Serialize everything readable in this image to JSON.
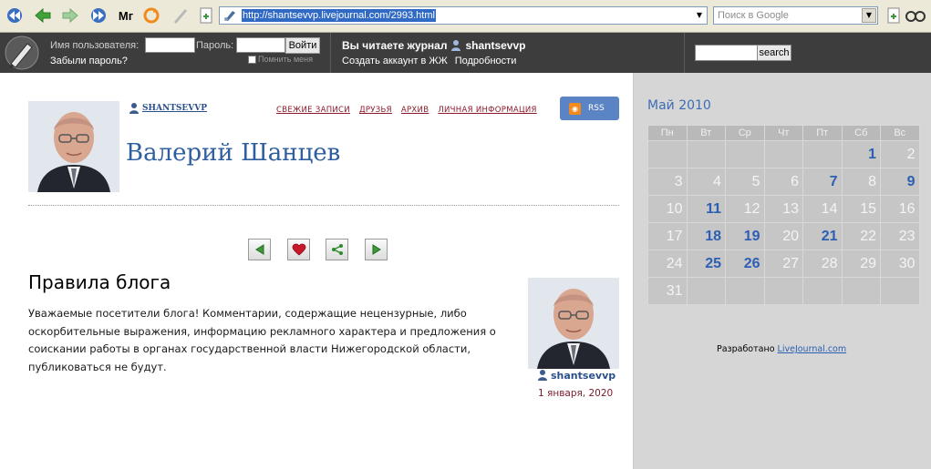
{
  "browser": {
    "url": "http://shantsevvp.livejournal.com/2993.html",
    "search_placeholder": "Поиск в Google",
    "toolbar_label": "Мг"
  },
  "ljbar": {
    "username_label": "Имя пользователя:",
    "password_label": "Пароль:",
    "login_button": "Войти",
    "forgot_password": "Забыли пароль?",
    "remember_me": "Помнить меня",
    "reading_label": "Вы читаете журнал",
    "journal_user": "shantsevvp",
    "create_account": "Создать аккаунт в ЖЖ",
    "details": "Подробности",
    "search_button": "search"
  },
  "header": {
    "username": "SHANTSEVVP",
    "nav": [
      "СВЕЖИЕ ЗАПИСИ",
      "ДРУЗЬЯ",
      "АРХИВ",
      "ЛИЧНАЯ ИНФОРМАЦИЯ"
    ],
    "rss": "RSS",
    "blog_title": "Валерий Шанцев"
  },
  "post": {
    "title": "Правила блога",
    "body": "Уважаемые посетители блога! Комментарии, содержащие нецензурные, либо оскорбительные выражения, информацию рекламного характера и предложения о соискании работы в органах государственной власти Нижегородской области, публиковаться не будут.",
    "author": "shantsevvp",
    "date": "1 января, 2020"
  },
  "calendar": {
    "title": "Май 2010",
    "weekdays": [
      "Пн",
      "Вт",
      "Ср",
      "Чт",
      "Пт",
      "Сб",
      "Вс"
    ],
    "weeks": [
      [
        null,
        null,
        null,
        null,
        null,
        "1",
        "2"
      ],
      [
        "3",
        "4",
        "5",
        "6",
        "7",
        "8",
        "9"
      ],
      [
        "10",
        "11",
        "12",
        "13",
        "14",
        "15",
        "16"
      ],
      [
        "17",
        "18",
        "19",
        "20",
        "21",
        "22",
        "23"
      ],
      [
        "24",
        "25",
        "26",
        "27",
        "28",
        "29",
        "30"
      ],
      [
        "31",
        null,
        null,
        null,
        null,
        null,
        null
      ]
    ],
    "linked_days": [
      "1",
      "7",
      "9",
      "11",
      "18",
      "19",
      "21",
      "25",
      "26"
    ]
  },
  "credit": {
    "prefix": "Разработано",
    "link": "LiveJournal.com"
  },
  "colors": {
    "accent": "#2f5e9e",
    "nav_link": "#8b1a2a",
    "lj_bar": "#3d3d3d",
    "rss": "#5b84c4"
  }
}
